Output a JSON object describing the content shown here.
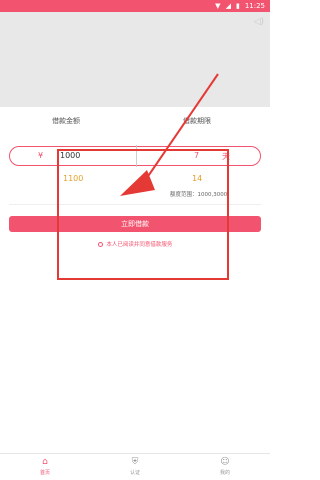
{
  "status_bar": {
    "time": "11:25"
  },
  "form": {
    "amount_label": "借款金额",
    "term_label": "借款期限",
    "currency_symbol": "¥",
    "amount_value": "1000",
    "term_value": "7",
    "term_unit": "天",
    "total_repay": "1100",
    "days": "14",
    "limit_text": "额度范围：1000,3000"
  },
  "buttons": {
    "submit_label": "立即借款"
  },
  "agreement": {
    "text": "本人已阅读并同意借款服务"
  },
  "tabs": [
    {
      "label": "首页",
      "icon": "home-icon"
    },
    {
      "label": "认证",
      "icon": "shield-icon"
    },
    {
      "label": "我的",
      "icon": "user-icon"
    }
  ],
  "colors": {
    "accent": "#f2546f",
    "value_orange": "#e5a12a",
    "annotation_red": "#e53935"
  }
}
